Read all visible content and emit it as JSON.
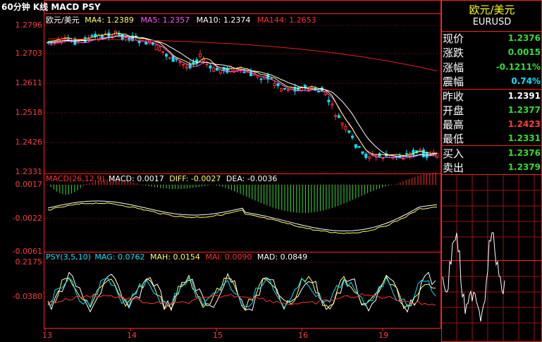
{
  "header": {
    "title": "60分钟 K线 MACD PSY"
  },
  "main_legend": {
    "symbol": "欧元/美元",
    "ma4": "MA4: 1.2389",
    "ma5": "MA5: 1.2357",
    "ma10": "MA10: 1.2374",
    "ma144": "MA144: 1.2653"
  },
  "main_axis": [
    "1.2796",
    "1.2703",
    "1.2611",
    "1.2518",
    "1.2426",
    "1.2331"
  ],
  "macd_legend": {
    "name": "MACD(26,12,9)",
    "macd": "MACD: 0.0017",
    "diff": "DIFF: -0.0027",
    "dea": "DEA: -0.0036"
  },
  "macd_axis": [
    "0.0017",
    "-0.0022",
    "-0.0061"
  ],
  "psy_legend": {
    "name": "PSY(3,5,10)",
    "mag": "MAG: 0.0762",
    "mah": "MAH: 0.0154",
    "mai": "MAI: 0.0090",
    "mad": "MAD: 0.0849"
  },
  "psy_axis": [
    "0.2175",
    "-0.0380"
  ],
  "x_axis": [
    "13",
    "14",
    "15",
    "16",
    "19"
  ],
  "info_panel": {
    "title": "欧元/美元",
    "code": "EURUSD",
    "rows": [
      {
        "label": "现价",
        "value": "1.2376",
        "color": "#33dd33"
      },
      {
        "label": "涨跌",
        "value": "0.0015",
        "color": "#33dd33"
      },
      {
        "label": "涨幅",
        "value": "-0.1211%",
        "color": "#33dd33"
      },
      {
        "label": "震幅",
        "value": "0.74%",
        "color": "#00e5ff"
      },
      {
        "label": "昨收",
        "value": "1.2391",
        "color": "#ffffff"
      },
      {
        "label": "开盘",
        "value": "1.2377",
        "color": "#33dd33"
      },
      {
        "label": "最高",
        "value": "1.2423",
        "color": "#ff3b3b"
      },
      {
        "label": "最低",
        "value": "1.2331",
        "color": "#33dd33"
      },
      {
        "label": "买入",
        "value": "1.2376",
        "color": "#33dd33"
      },
      {
        "label": "卖出",
        "value": "1.2379",
        "color": "#33dd33"
      }
    ]
  },
  "colors": {
    "frame": "#ff2020",
    "up": "#ff3030",
    "down": "#00e5ff",
    "ma4": "#ffff66",
    "ma5": "#ff55ff",
    "ma10": "#ffffff",
    "ma144": "#e02020",
    "macd_up": "#ff3030",
    "macd_down": "#33dd33"
  }
}
